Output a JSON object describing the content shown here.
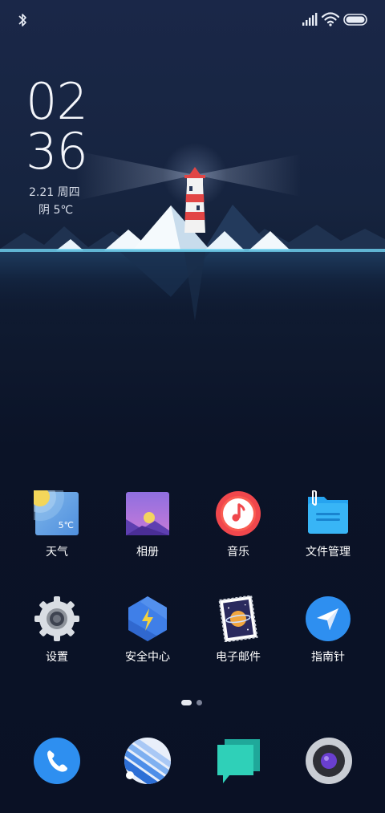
{
  "status_bar": {
    "icons": [
      "bluetooth-icon",
      "signal-icon",
      "wifi-icon",
      "battery-icon"
    ]
  },
  "clock": {
    "hours": "02",
    "minutes": "36",
    "date": "2.21 周四",
    "weather": "阴 5℃"
  },
  "apps": [
    {
      "label": "天气",
      "icon": "weather-icon",
      "badge": "5℃"
    },
    {
      "label": "相册",
      "icon": "gallery-icon"
    },
    {
      "label": "音乐",
      "icon": "music-icon"
    },
    {
      "label": "文件管理",
      "icon": "file-manager-icon"
    },
    {
      "label": "设置",
      "icon": "settings-icon"
    },
    {
      "label": "安全中心",
      "icon": "security-icon"
    },
    {
      "label": "电子邮件",
      "icon": "email-icon"
    },
    {
      "label": "指南针",
      "icon": "compass-icon"
    }
  ],
  "dock": [
    {
      "icon": "phone-icon"
    },
    {
      "icon": "browser-icon"
    },
    {
      "icon": "messages-icon"
    },
    {
      "icon": "camera-icon"
    }
  ],
  "pager": {
    "pages": 2,
    "current": 1
  },
  "colors": {
    "background": "#0b1327",
    "music_accent": "#f0474c",
    "compass_accent": "#2e8ff0",
    "phone_accent": "#2e8ff0",
    "messages_accent": "#2fd0b8"
  }
}
